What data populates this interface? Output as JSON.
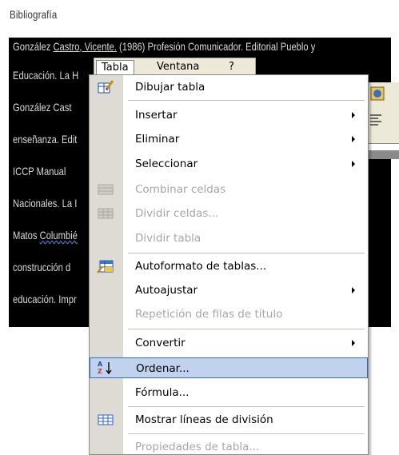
{
  "heading": "Bibliografía",
  "document": {
    "lines": [
      "González Castro, Vicente. (1986) Profesión Comunicador. Editorial Pueblo y",
      "Educación. La H",
      "González Cast",
      "enseñanza. Edit",
      "ICCP  Manual",
      "Nacionales. La I",
      "Matos Columbié",
      "construcción  d",
      "educación. Impr"
    ],
    "wavy_word": "Columbié",
    "underlined_word": "Castro, Vicente."
  },
  "menubar": {
    "items": [
      {
        "label": "Tabla",
        "active": true
      },
      {
        "label": "Ventana",
        "active": false
      },
      {
        "label": "?",
        "active": false
      }
    ]
  },
  "menu": {
    "items": [
      {
        "label": "Dibujar tabla",
        "disabled": false,
        "submenu": false,
        "icon": "draw-table-icon"
      },
      {
        "label": "Insertar",
        "disabled": false,
        "submenu": true,
        "icon": ""
      },
      {
        "label": "Eliminar",
        "disabled": false,
        "submenu": true,
        "icon": ""
      },
      {
        "label": "Seleccionar",
        "disabled": false,
        "submenu": true,
        "icon": ""
      },
      {
        "label": "Combinar celdas",
        "disabled": true,
        "submenu": false,
        "icon": "merge-cells-icon"
      },
      {
        "label": "Dividir celdas...",
        "disabled": true,
        "submenu": false,
        "icon": "split-cells-icon"
      },
      {
        "label": "Dividir tabla",
        "disabled": true,
        "submenu": false,
        "icon": ""
      },
      {
        "label": "Autoformato de tablas...",
        "disabled": false,
        "submenu": false,
        "icon": "table-autoformat-icon"
      },
      {
        "label": "Autoajustar",
        "disabled": false,
        "submenu": true,
        "icon": ""
      },
      {
        "label": "Repetición de filas de título",
        "disabled": true,
        "submenu": false,
        "icon": ""
      },
      {
        "label": "Convertir",
        "disabled": false,
        "submenu": true,
        "icon": ""
      },
      {
        "label": "Ordenar...",
        "disabled": false,
        "submenu": false,
        "icon": "sort-az-icon",
        "highlighted": true
      },
      {
        "label": "Fórmula...",
        "disabled": false,
        "submenu": false,
        "icon": ""
      },
      {
        "label": "Mostrar líneas de división",
        "disabled": false,
        "submenu": false,
        "icon": "gridlines-icon"
      },
      {
        "label": "Propiedades de tabla...",
        "disabled": true,
        "submenu": false,
        "icon": ""
      }
    ]
  },
  "colors": {
    "menu_highlight": "#c1d2ee",
    "menu_highlight_border": "#316ac5",
    "disabled_text": "#a7a6aa",
    "gutter": "#dddbd3"
  }
}
